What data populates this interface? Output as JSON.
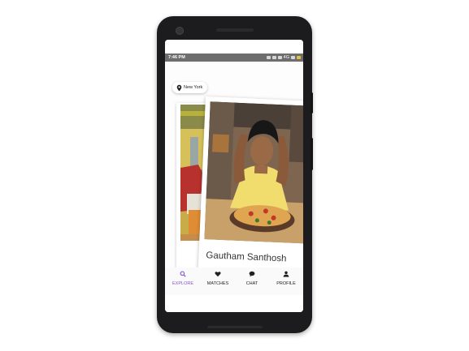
{
  "status_bar": {
    "time": "7:46 PM",
    "network": "4G"
  },
  "location_chip": {
    "label": "New York"
  },
  "card": {
    "name": "Gautham Santhosh"
  },
  "bottom_nav": {
    "items": [
      {
        "label": "EXPLORE",
        "icon": "search-icon",
        "active": true
      },
      {
        "label": "MATCHES",
        "icon": "heart-icon",
        "active": false
      },
      {
        "label": "CHAT",
        "icon": "chat-bubble-icon",
        "active": false
      },
      {
        "label": "PROFILE",
        "icon": "person-icon",
        "active": false
      }
    ]
  },
  "colors": {
    "accent": "#8b55d6",
    "status_bar": "#6e6e6e",
    "phone_frame": "#1c1c1e"
  }
}
